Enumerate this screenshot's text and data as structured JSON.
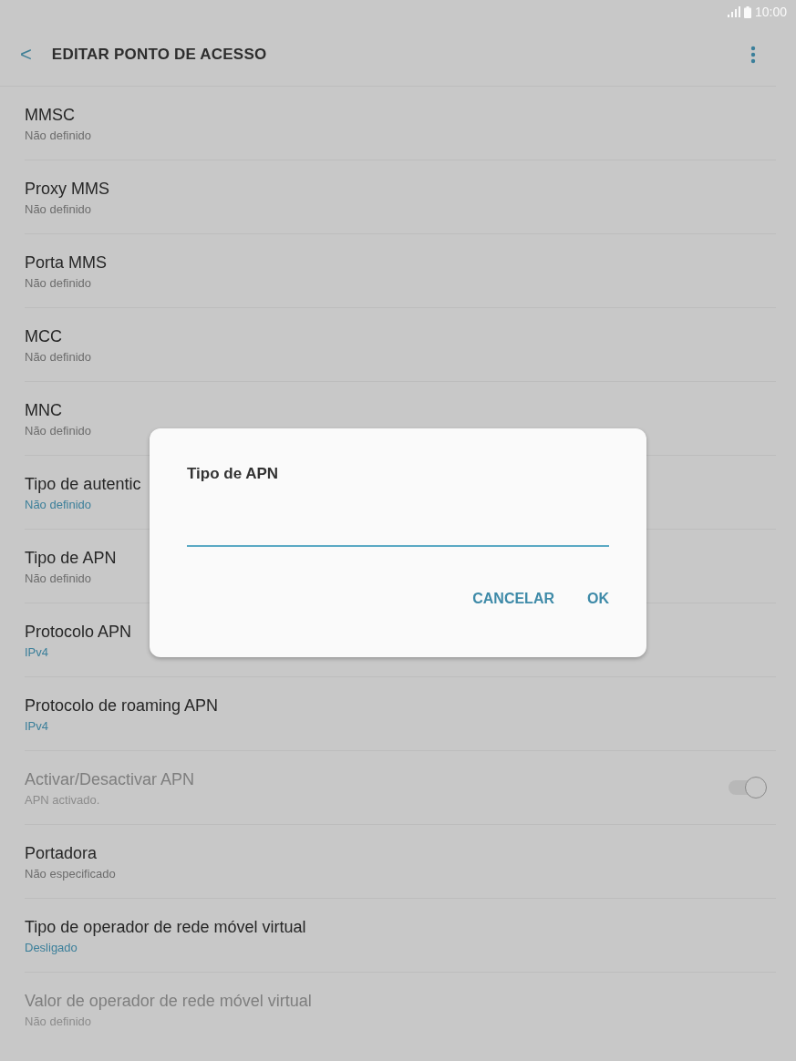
{
  "status_bar": {
    "time": "10:00"
  },
  "header": {
    "back": "<",
    "title": "EDITAR PONTO DE ACESSO"
  },
  "settings": [
    {
      "title": "MMSC",
      "value": "Não definido",
      "highlighted": false,
      "disabled": false
    },
    {
      "title": "Proxy MMS",
      "value": "Não definido",
      "highlighted": false,
      "disabled": false
    },
    {
      "title": "Porta MMS",
      "value": "Não definido",
      "highlighted": false,
      "disabled": false
    },
    {
      "title": "MCC",
      "value": "Não definido",
      "highlighted": false,
      "disabled": false
    },
    {
      "title": "MNC",
      "value": "Não definido",
      "highlighted": false,
      "disabled": false
    },
    {
      "title": "Tipo de autentic",
      "value": "Não definido",
      "highlighted": true,
      "disabled": false
    },
    {
      "title": "Tipo de APN",
      "value": "Não definido",
      "highlighted": false,
      "disabled": false
    },
    {
      "title": "Protocolo APN",
      "value": "IPv4",
      "highlighted": true,
      "disabled": false
    },
    {
      "title": "Protocolo de roaming APN",
      "value": "IPv4",
      "highlighted": true,
      "disabled": false
    },
    {
      "title": "Activar/Desactivar APN",
      "value": "APN activado.",
      "highlighted": false,
      "disabled": true,
      "toggle": {
        "on": true
      }
    },
    {
      "title": "Portadora",
      "value": "Não especificado",
      "highlighted": false,
      "disabled": false
    },
    {
      "title": "Tipo de operador de rede móvel virtual",
      "value": "Desligado",
      "highlighted": true,
      "disabled": false
    },
    {
      "title": "Valor de operador de rede móvel virtual",
      "value": "Não definido",
      "highlighted": false,
      "disabled": true
    }
  ],
  "dialog": {
    "title": "Tipo de APN",
    "buttons": [
      "CANCELAR",
      "OK"
    ]
  }
}
